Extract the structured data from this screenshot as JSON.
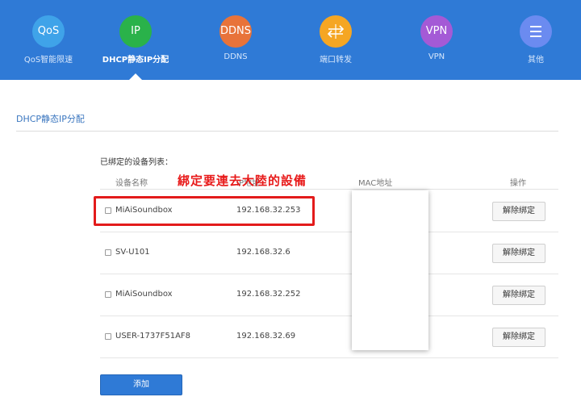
{
  "nav": {
    "items": [
      {
        "icon_text": "QoS",
        "label": "QoS智能限速",
        "color": "#3fa3e9",
        "icon": "qos-icon",
        "active": false
      },
      {
        "icon_text": "IP",
        "label": "DHCP静态IP分配",
        "color": "#2ab24a",
        "icon": "ip-icon",
        "active": true
      },
      {
        "icon_text": "DDNS",
        "label": "DDNS",
        "color": "#e8733a",
        "icon": "ddns-icon",
        "active": false
      },
      {
        "icon_text": "",
        "label": "端口转发",
        "color": "#f5a623",
        "icon": "port-forward-icon",
        "active": false
      },
      {
        "icon_text": "VPN",
        "label": "VPN",
        "color": "#a45ad6",
        "icon": "vpn-icon",
        "active": false
      },
      {
        "icon_text": "",
        "label": "其他",
        "color": "#6b8bf0",
        "icon": "menu-icon",
        "active": false
      }
    ]
  },
  "section": {
    "title": "DHCP静态IP分配"
  },
  "table": {
    "title": "已绑定的设备列表：",
    "headers": {
      "name": "设备名称",
      "ip": "IP地址",
      "mac": "MAC地址",
      "action": "操作"
    },
    "rows": [
      {
        "name": "MiAiSoundbox",
        "ip": "192.168.32.253",
        "action": "解除绑定"
      },
      {
        "name": "SV-U101",
        "ip": "192.168.32.6",
        "action": "解除绑定"
      },
      {
        "name": "MiAiSoundbox",
        "ip": "192.168.32.252",
        "action": "解除绑定"
      },
      {
        "name": "USER-1737F51AF8",
        "ip": "192.168.32.69",
        "action": "解除绑定"
      }
    ]
  },
  "annotation": {
    "text": "綁定要連去大陸的設備",
    "color": "#e81919"
  },
  "add_button": {
    "label": "添加"
  }
}
